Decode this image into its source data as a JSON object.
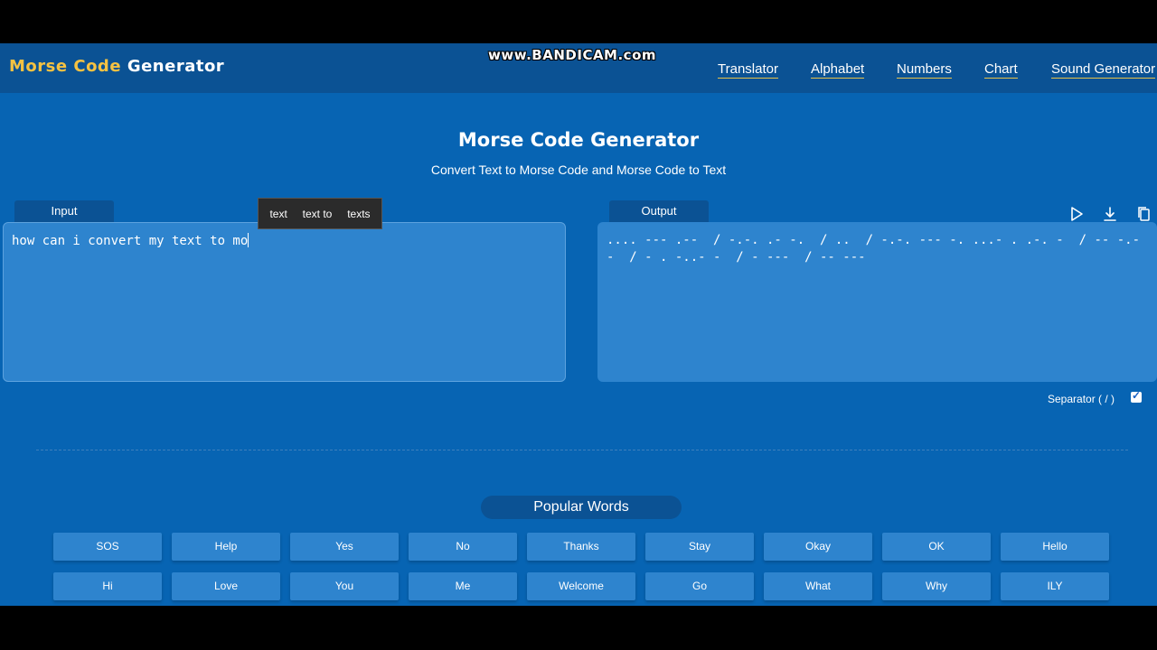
{
  "header": {
    "logo_word1": "Morse",
    "logo_word2": "Code",
    "logo_word3": "Generator",
    "watermark": "www.BANDICAM.com",
    "nav": [
      "Translator",
      "Alphabet",
      "Numbers",
      "Chart",
      "Sound Generator"
    ]
  },
  "hero": {
    "title": "Morse Code Generator",
    "subtitle": "Convert Text to Morse Code and Morse Code to Text"
  },
  "input": {
    "tab_label": "Input",
    "value": "how can i convert my text to mo"
  },
  "suggestions": [
    "text",
    "text to",
    "texts"
  ],
  "output": {
    "tab_label": "Output",
    "value": ".... --- .--  / -.-. .- -.  / ..  / -.-. --- -. ...- . .-. -  / -- -.--  / - . -..- -  / - ---  / -- ---",
    "icons": [
      "play-icon",
      "download-icon",
      "copy-icon"
    ]
  },
  "separator": {
    "label": "Separator ( / )",
    "checked": true
  },
  "popular": {
    "title": "Popular Words",
    "row1": [
      "SOS",
      "Help",
      "Yes",
      "No",
      "Thanks",
      "Stay",
      "Okay",
      "OK",
      "Hello"
    ],
    "row2": [
      "Hi",
      "Love",
      "You",
      "Me",
      "Welcome",
      "Go",
      "What",
      "Why",
      "ILY"
    ]
  },
  "colors": {
    "background": "#0764b3",
    "header": "#0b5294",
    "panel": "#2e84ce",
    "accent": "#f5c242"
  }
}
